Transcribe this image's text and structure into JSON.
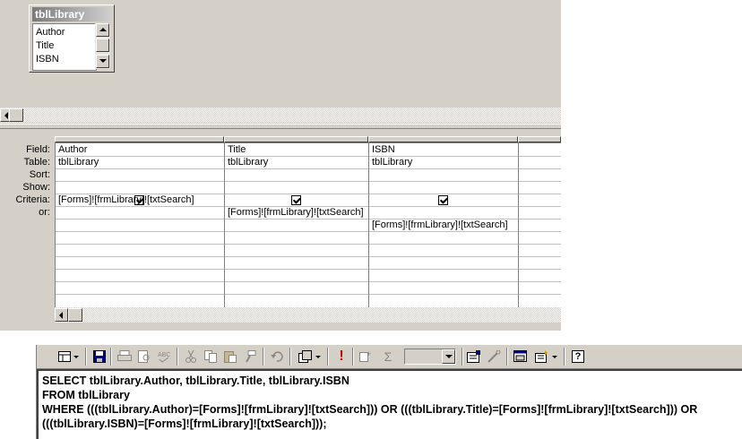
{
  "field_list": {
    "title": "tblLibrary",
    "items": [
      "Author",
      "Title",
      "ISBN"
    ]
  },
  "grid": {
    "row_labels": [
      "Field:",
      "Table:",
      "Sort:",
      "Show:",
      "Criteria:",
      "or:"
    ],
    "columns": [
      {
        "field": "Author",
        "table": "tblLibrary",
        "show": true,
        "criteria": "[Forms]![frmLibrary]![txtSearch]",
        "or": "",
        "or2": ""
      },
      {
        "field": "Title",
        "table": "tblLibrary",
        "show": true,
        "criteria": "",
        "or": "[Forms]![frmLibrary]![txtSearch]",
        "or2": ""
      },
      {
        "field": "ISBN",
        "table": "tblLibrary",
        "show": true,
        "criteria": "",
        "or": "",
        "or2": "[Forms]![frmLibrary]![txtSearch]"
      }
    ]
  },
  "toolbar": {
    "icons": [
      "view-icon",
      "save-icon",
      "print-icon",
      "print-preview-icon",
      "spelling-icon",
      "cut-icon",
      "copy-icon",
      "paste-icon",
      "format-painter-icon",
      "undo-icon",
      "query-type-icon",
      "run-icon",
      "show-table-icon",
      "totals-icon",
      "top-values-icon",
      "properties-icon",
      "build-icon",
      "database-window-icon",
      "new-object-icon",
      "help-icon"
    ],
    "glyphs": {
      "run": "!",
      "totals": "Σ",
      "help": "?"
    },
    "colors": {
      "run": "#cc0000"
    }
  },
  "sql": {
    "text": "SELECT tblLibrary.Author, tblLibrary.Title, tblLibrary.ISBN\nFROM tblLibrary\nWHERE (((tblLibrary.Author)=[Forms]![frmLibrary]![txtSearch])) OR (((tblLibrary.Title)=[Forms]![frmLibrary]![txtSearch])) OR (((tblLibrary.ISBN)=[Forms]![frmLibrary]![txtSearch]));"
  }
}
